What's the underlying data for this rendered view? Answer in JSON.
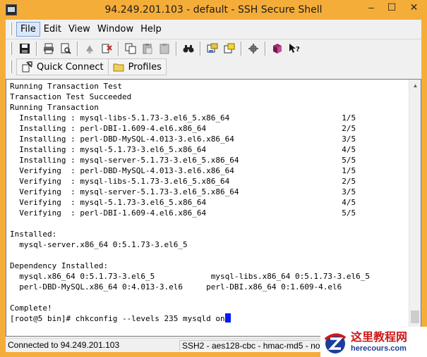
{
  "window": {
    "title": "94.249.201.103 - default - SSH Secure Shell",
    "controls": {
      "minimize": "–",
      "maximize": "☐",
      "close": "✕"
    }
  },
  "menu": [
    {
      "label": "File"
    },
    {
      "label": "Edit"
    },
    {
      "label": "View"
    },
    {
      "label": "Window"
    },
    {
      "label": "Help"
    }
  ],
  "toolbar": {
    "icons": [
      "save-icon",
      "print-icon",
      "print-preview-icon",
      "disconnect-icon",
      "new-connection-icon",
      "copy-icon",
      "paste-icon",
      "paste-alt-icon",
      "find-icon",
      "file-transfer-icon",
      "new-terminal-icon",
      "settings-icon",
      "help-book-icon",
      "context-help-icon"
    ]
  },
  "quickbar": {
    "quick_connect": "Quick Connect",
    "profiles": "Profiles"
  },
  "terminal": {
    "lines": [
      "Running Transaction Test",
      "Transaction Test Succeeded",
      "Running Transaction",
      "  Installing : mysql-libs-5.1.73-3.el6_5.x86_64                        1/5",
      "  Installing : perl-DBI-1.609-4.el6.x86_64                             2/5",
      "  Installing : perl-DBD-MySQL-4.013-3.el6.x86_64                       3/5",
      "  Installing : mysql-5.1.73-3.el6_5.x86_64                             4/5",
      "  Installing : mysql-server-5.1.73-3.el6_5.x86_64                      5/5",
      "  Verifying  : perl-DBD-MySQL-4.013-3.el6.x86_64                       1/5",
      "  Verifying  : mysql-libs-5.1.73-3.el6_5.x86_64                        2/5",
      "  Verifying  : mysql-server-5.1.73-3.el6_5.x86_64                      3/5",
      "  Verifying  : mysql-5.1.73-3.el6_5.x86_64                             4/5",
      "  Verifying  : perl-DBI-1.609-4.el6.x86_64                             5/5",
      "",
      "Installed:",
      "  mysql-server.x86_64 0:5.1.73-3.el6_5",
      "",
      "Dependency Installed:",
      "  mysql.x86_64 0:5.1.73-3.el6_5            mysql-libs.x86_64 0:5.1.73-3.el6_5",
      "  perl-DBD-MySQL.x86_64 0:4.013-3.el6     perl-DBI.x86_64 0:1.609-4.el6",
      "",
      "Complete!"
    ],
    "prompt": "[root@5 bin]# chkconfig --levels 235 mysqld on"
  },
  "statusbar": {
    "connection": "Connected to 94.249.201.103",
    "cipher": "SSH2 - aes128-cbc - hmac-md5 - no"
  },
  "watermark": {
    "cn": "这里教程网",
    "url": "herecours.com"
  },
  "colors": {
    "titlebar": "#f5ad3a",
    "cursor": "#0018ff",
    "watermark_red": "#cc1a1a",
    "watermark_blue": "#1a3e9a"
  }
}
